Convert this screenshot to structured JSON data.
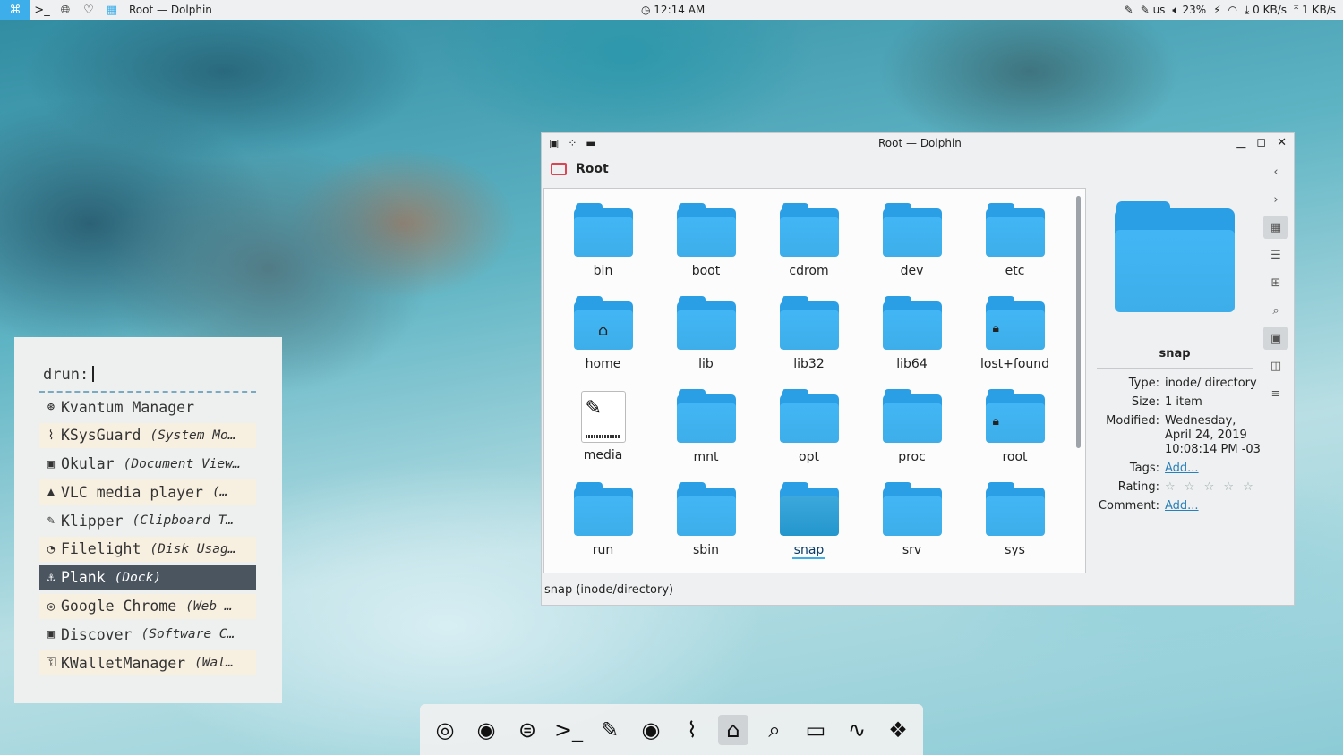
{
  "topbar": {
    "launcher_icon": "command-icon",
    "window_title": "Root — Dolphin",
    "clock": "12:14 AM",
    "keyboard_layout": "us",
    "volume": "23%",
    "net_down": "0 KB/s",
    "net_up": "1 KB/s"
  },
  "rofi": {
    "prompt": "drun:",
    "items": [
      {
        "name": "Kvantum Manager",
        "desc": ""
      },
      {
        "name": "KSysGuard",
        "desc": "(System Mo…"
      },
      {
        "name": "Okular",
        "desc": "(Document View…"
      },
      {
        "name": "VLC media player",
        "desc": "(…"
      },
      {
        "name": "Klipper",
        "desc": "(Clipboard T…"
      },
      {
        "name": "Filelight",
        "desc": "(Disk Usag…"
      },
      {
        "name": "Plank",
        "desc": "(Dock)"
      },
      {
        "name": "Google Chrome",
        "desc": "(Web …"
      },
      {
        "name": "Discover",
        "desc": "(Software C…"
      },
      {
        "name": "KWalletManager",
        "desc": "(Wal…"
      }
    ]
  },
  "dolphin": {
    "title": "Root — Dolphin",
    "location": "Root",
    "folders": [
      "bin",
      "boot",
      "cdrom",
      "dev",
      "etc",
      "home",
      "lib",
      "lib32",
      "lib64",
      "lost+found",
      "media",
      "mnt",
      "opt",
      "proc",
      "root",
      "run",
      "sbin",
      "snap",
      "srv",
      "sys"
    ],
    "selected": "snap",
    "status": "snap (inode/directory)",
    "info": {
      "name": "snap",
      "type_label": "Type:",
      "type": "inode/ directory",
      "size_label": "Size:",
      "size": "1 item",
      "modified_label": "Modified:",
      "modified": "Wednesday, April 24, 2019 10:08:14 PM -03",
      "tags_label": "Tags:",
      "tags": "Add...",
      "rating_label": "Rating:",
      "rating": "☆ ☆ ☆ ☆ ☆",
      "comment_label": "Comment:",
      "comment": "Add..."
    }
  }
}
